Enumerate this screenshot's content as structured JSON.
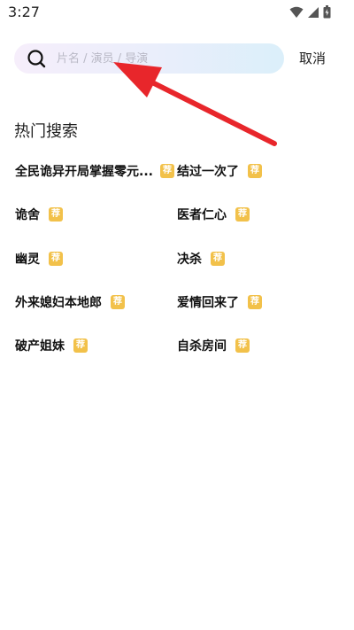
{
  "status": {
    "time": "3:27"
  },
  "search": {
    "placeholder": "片名 / 演员 / 导演",
    "value": "",
    "cancel_label": "取消"
  },
  "hot_search": {
    "title": "热门搜索",
    "badge_label": "荐",
    "items": [
      {
        "label": "全民诡异开局掌握零元..."
      },
      {
        "label": "结过一次了"
      },
      {
        "label": "诡舍"
      },
      {
        "label": "医者仁心"
      },
      {
        "label": "幽灵"
      },
      {
        "label": "决杀"
      },
      {
        "label": "外来媳妇本地郎"
      },
      {
        "label": "爱情回来了"
      },
      {
        "label": "破产姐妹"
      },
      {
        "label": "自杀房间"
      }
    ]
  },
  "colors": {
    "badge": "#f2c14a",
    "arrow": "#e8262b",
    "search_gradient_start": "#f6eefb",
    "search_gradient_end": "#dbeffa"
  }
}
